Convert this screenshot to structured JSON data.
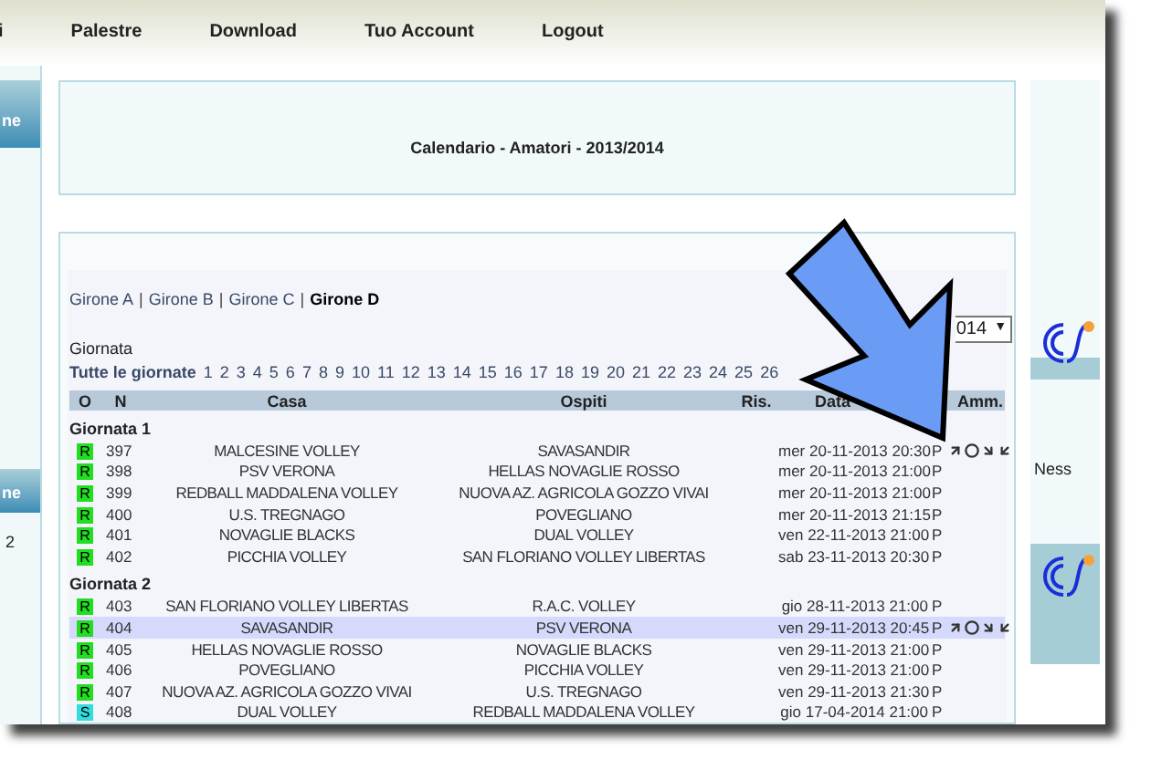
{
  "nav": {
    "items": [
      "i",
      "Palestre",
      "Download",
      "Tuo Account",
      "Logout"
    ]
  },
  "left_sidebar": {
    "tabs": [
      "ne",
      "ne"
    ],
    "text": "2"
  },
  "title": "Calendario - Amatori - 2013/2014",
  "gironi": [
    {
      "label": "Girone A",
      "selected": false
    },
    {
      "label": "Girone B",
      "selected": false
    },
    {
      "label": "Girone C",
      "selected": false
    },
    {
      "label": "Girone D",
      "selected": true
    }
  ],
  "gironi_separator": "|",
  "season_select": {
    "value": "014",
    "arrow": "▼"
  },
  "giornata_label": "Giornata",
  "giornate": [
    "Tutte le giornate",
    "1",
    "2",
    "3",
    "4",
    "5",
    "6",
    "7",
    "8",
    "9",
    "10",
    "11",
    "12",
    "13",
    "14",
    "15",
    "16",
    "17",
    "18",
    "19",
    "20",
    "21",
    "22",
    "23",
    "24",
    "25",
    "26"
  ],
  "table": {
    "columns": [
      "O",
      "N",
      "Casa",
      "Ospiti",
      "Ris.",
      "Data",
      "Amm."
    ],
    "groups": [
      {
        "title": "Giornata 1",
        "rows": [
          {
            "badge": "R",
            "color": "#22dd22",
            "n": "397",
            "casa": "MALCESINE VOLLEY",
            "ospiti": "SAVASANDIR",
            "data": "mer 20-11-2013 20:30",
            "p": "P",
            "admin": true,
            "selected": false
          },
          {
            "badge": "R",
            "color": "#22dd22",
            "n": "398",
            "casa": "PSV VERONA",
            "ospiti": "HELLAS NOVAGLIE ROSSO",
            "data": "mer 20-11-2013 21:00",
            "p": "P",
            "admin": false,
            "selected": false
          },
          {
            "badge": "R",
            "color": "#22dd22",
            "n": "399",
            "casa": "REDBALL MADDALENA VOLLEY",
            "ospiti": "NUOVA AZ. AGRICOLA GOZZO VIVAI",
            "data": "mer 20-11-2013 21:00",
            "p": "P",
            "admin": false,
            "selected": false
          },
          {
            "badge": "R",
            "color": "#22dd22",
            "n": "400",
            "casa": "U.S. TREGNAGO",
            "ospiti": "POVEGLIANO",
            "data": "mer 20-11-2013 21:15",
            "p": "P",
            "admin": false,
            "selected": false
          },
          {
            "badge": "R",
            "color": "#22dd22",
            "n": "401",
            "casa": "NOVAGLIE BLACKS",
            "ospiti": "DUAL VOLLEY",
            "data": "ven 22-11-2013 21:00",
            "p": "P",
            "admin": false,
            "selected": false
          },
          {
            "badge": "R",
            "color": "#22dd22",
            "n": "402",
            "casa": "PICCHIA VOLLEY",
            "ospiti": "SAN FLORIANO VOLLEY LIBERTAS",
            "data": "sab 23-11-2013 20:30",
            "p": "P",
            "admin": false,
            "selected": false
          }
        ]
      },
      {
        "title": "Giornata 2",
        "rows": [
          {
            "badge": "R",
            "color": "#22dd22",
            "n": "403",
            "casa": "SAN FLORIANO VOLLEY LIBERTAS",
            "ospiti": "R.A.C. VOLLEY",
            "data": "gio 28-11-2013 21:00",
            "p": "P",
            "admin": false,
            "selected": false
          },
          {
            "badge": "R",
            "color": "#22dd22",
            "n": "404",
            "casa": "SAVASANDIR",
            "ospiti": "PSV VERONA",
            "data": "ven 29-11-2013 20:45",
            "p": "P",
            "admin": true,
            "selected": true
          },
          {
            "badge": "R",
            "color": "#22dd22",
            "n": "405",
            "casa": "HELLAS NOVAGLIE ROSSO",
            "ospiti": "NOVAGLIE BLACKS",
            "data": "ven 29-11-2013 21:00",
            "p": "P",
            "admin": false,
            "selected": false
          },
          {
            "badge": "R",
            "color": "#22dd22",
            "n": "406",
            "casa": "POVEGLIANO",
            "ospiti": "PICCHIA VOLLEY",
            "data": "ven 29-11-2013 21:00",
            "p": "P",
            "admin": false,
            "selected": false
          },
          {
            "badge": "R",
            "color": "#22dd22",
            "n": "407",
            "casa": "NUOVA AZ. AGRICOLA GOZZO VIVAI",
            "ospiti": "U.S. TREGNAGO",
            "data": "ven 29-11-2013 21:30",
            "p": "P",
            "admin": false,
            "selected": false
          },
          {
            "badge": "S",
            "color": "#33dddd",
            "n": "408",
            "casa": "DUAL VOLLEY",
            "ospiti": "REDBALL MADDALENA VOLLEY",
            "data": "gio 17-04-2014 21:00",
            "p": "P",
            "admin": false,
            "selected": false
          }
        ]
      }
    ]
  },
  "right_sidebar": {
    "text": "Ness"
  }
}
